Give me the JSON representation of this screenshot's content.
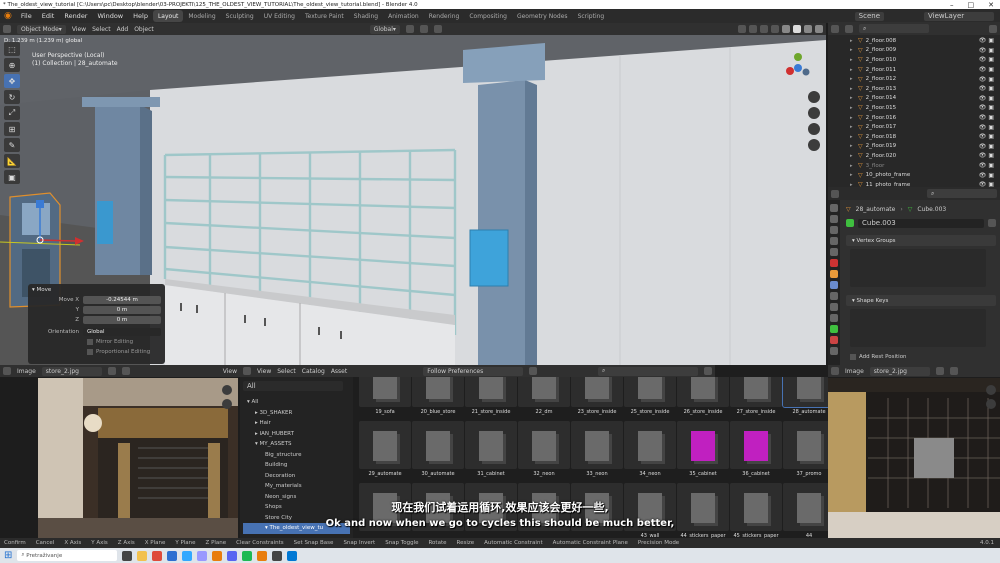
{
  "window": {
    "title": "* The_oldest_view_tutorial [C:\\Users\\pc\\Desktop\\blender\\03-PROJEKTI\\125_THE_OLDEST_VIEW_TUTORIAL\\The_oldest_view_tutorial.blend] - Blender 4.0"
  },
  "menubar": {
    "menus": [
      "File",
      "Edit",
      "Render",
      "Window",
      "Help"
    ],
    "workspaces": [
      "Layout",
      "Modeling",
      "Sculpting",
      "UV Editing",
      "Texture Paint",
      "Shading",
      "Animation",
      "Rendering",
      "Compositing",
      "Geometry Nodes",
      "Scripting"
    ],
    "active_workspace": "Layout",
    "scene_label": "Scene",
    "viewlayer_label": "ViewLayer"
  },
  "viewport_header": {
    "info": "D: 1.239 m (1.239 m) global",
    "mode": "Object Mode",
    "menus": [
      "View",
      "Select",
      "Add",
      "Object"
    ],
    "orientation": "Global"
  },
  "viewport": {
    "perspective": "User Perspective (Local)",
    "collection": "(1) Collection | 28_automate"
  },
  "move_panel": {
    "title": "Move",
    "fields": [
      {
        "label": "Move X",
        "value": "-0.24544 m"
      },
      {
        "label": "Y",
        "value": "0 m"
      },
      {
        "label": "Z",
        "value": "0 m"
      }
    ],
    "orientation_label": "Orientation",
    "orientation_value": "Global",
    "mirror_editing": "Mirror Editing",
    "proportional_editing": "Proportional Editing"
  },
  "outliner": {
    "items": [
      "2_floor.008",
      "2_floor.009",
      "2_floor.010",
      "2_floor.011",
      "2_floor.012",
      "2_floor.013",
      "2_floor.014",
      "2_floor.015",
      "2_floor.016",
      "2_floor.017",
      "2_floor.018",
      "2_floor.019",
      "2_floor.020",
      "3_floor",
      "10_photo_frame",
      "11_photo_frame"
    ]
  },
  "properties": {
    "object_name": "28_automate",
    "mesh_name": "Cube.003",
    "data_field": "Cube.003",
    "vertex_groups": "Vertex Groups",
    "shape_keys": "Shape Keys",
    "add_rest_position": "Add Rest Position"
  },
  "image_editor_left": {
    "label": "Image",
    "file": "store_2.jpg",
    "view": "View"
  },
  "image_editor_right": {
    "label": "Image",
    "file": "store_2.jpg"
  },
  "asset_browser": {
    "menus": [
      "View",
      "Select",
      "Catalog",
      "Asset"
    ],
    "library": "Follow Preferences",
    "filter": "All",
    "tree": [
      {
        "label": "All",
        "level": 0
      },
      {
        "label": "3D_SHAKER",
        "level": 1
      },
      {
        "label": "Hair",
        "level": 1
      },
      {
        "label": "IAN_HUBERT",
        "level": 1
      },
      {
        "label": "MY_ASSETS",
        "level": 1
      },
      {
        "label": "Big_structure",
        "level": 2
      },
      {
        "label": "Building",
        "level": 2
      },
      {
        "label": "Decoration",
        "level": 2
      },
      {
        "label": "My_materials",
        "level": 2
      },
      {
        "label": "Neon_signs",
        "level": 2
      },
      {
        "label": "Shops",
        "level": 2
      },
      {
        "label": "Store City",
        "level": 2
      },
      {
        "label": "The_oldest_view_tu",
        "level": 2
      }
    ],
    "assets": [
      "19_sofa",
      "20_blue_store",
      "21_store_inside",
      "22_dm",
      "23_store_inside",
      "25_store_inside",
      "26_store_inside",
      "27_store_inside",
      "28_automate",
      "29_automate",
      "30_automate",
      "31_cabinet",
      "32_neon",
      "33_neon",
      "34_neon",
      "35_cabinet",
      "36_cabinet",
      "37_promo",
      "",
      "",
      "",
      "",
      "",
      "43_wall",
      "44_stickers_paper",
      "45_stickers_paper",
      "44"
    ],
    "selected_asset": "28_automate"
  },
  "statusbar": {
    "items": [
      "Confirm",
      "Cancel",
      "X Axis",
      "Y Axis",
      "Z Axis",
      "X Plane",
      "Y Plane",
      "Z Plane",
      "Clear Constraints",
      "Set Snap Base",
      "Snap Invert",
      "Snap Toggle",
      "Rotate",
      "Resize",
      "Automatic Constraint",
      "Automatic Constraint Plane",
      "Precision Mode"
    ],
    "version": "4.0.1"
  },
  "taskbar": {
    "search_placeholder": "Pretraživanje"
  },
  "subtitles": {
    "chinese": "现在我们试着运用循环,效果应该会更好一些,",
    "english": "Ok and now when we go to cycles this should be much better,"
  },
  "colors": {
    "accent": "#4772b3",
    "magenta_cabinet": "#c020c0",
    "pillar_blue": "#7a93ad",
    "wall": "#d6d8db"
  }
}
